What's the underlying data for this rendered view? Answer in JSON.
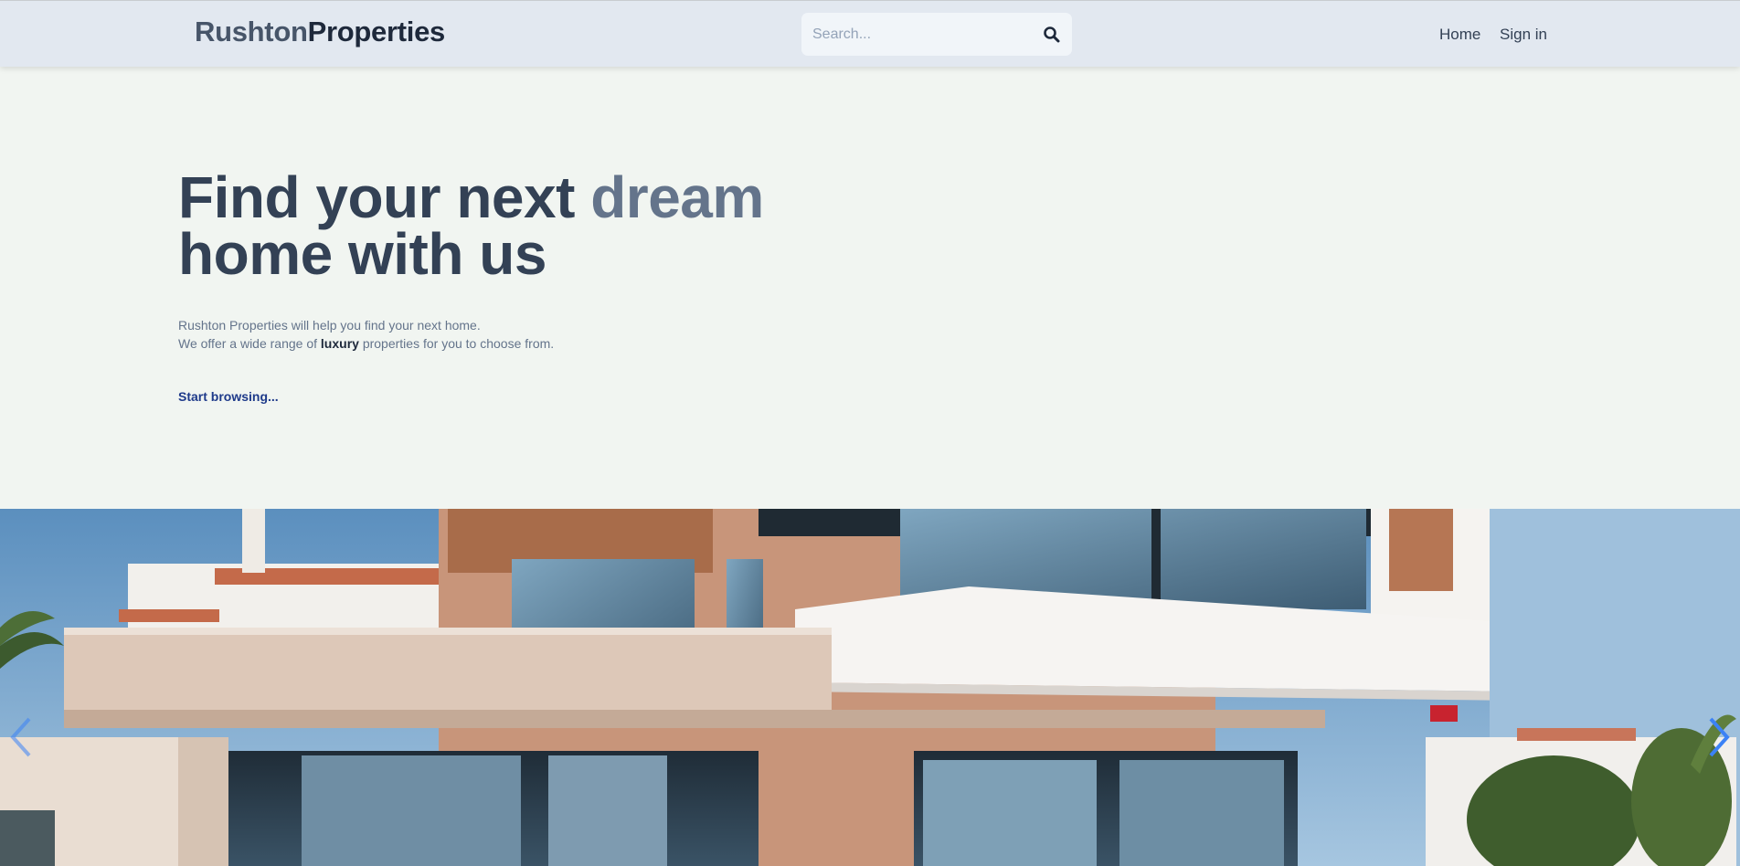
{
  "header": {
    "brand_part1": "Rushton",
    "brand_part2": "Properties",
    "search_placeholder": "Search...",
    "nav": [
      {
        "label": "Home"
      },
      {
        "label": "Sign in"
      }
    ]
  },
  "hero": {
    "title_part1": "Find your next ",
    "title_accent": "dream",
    "title_line2": "home with us",
    "text_line1": "Rushton Properties will help you find your next home.",
    "text_line2_before": "We offer a wide range of ",
    "text_line2_bold": "luxury",
    "text_line2_after": " properties for you to choose from.",
    "cta": "Start browsing..."
  },
  "carousel": {
    "image_subject": "modern luxury villa with glass balconies",
    "prev_icon": "chevron-left-icon",
    "next_icon": "chevron-right-icon"
  },
  "colors": {
    "navbar_bg": "#e2e8f0",
    "page_bg": "#f1f5f1",
    "heading": "#334155",
    "accent": "#64748b",
    "link": "#1e3a8a",
    "arrow": "#3b82f6"
  }
}
